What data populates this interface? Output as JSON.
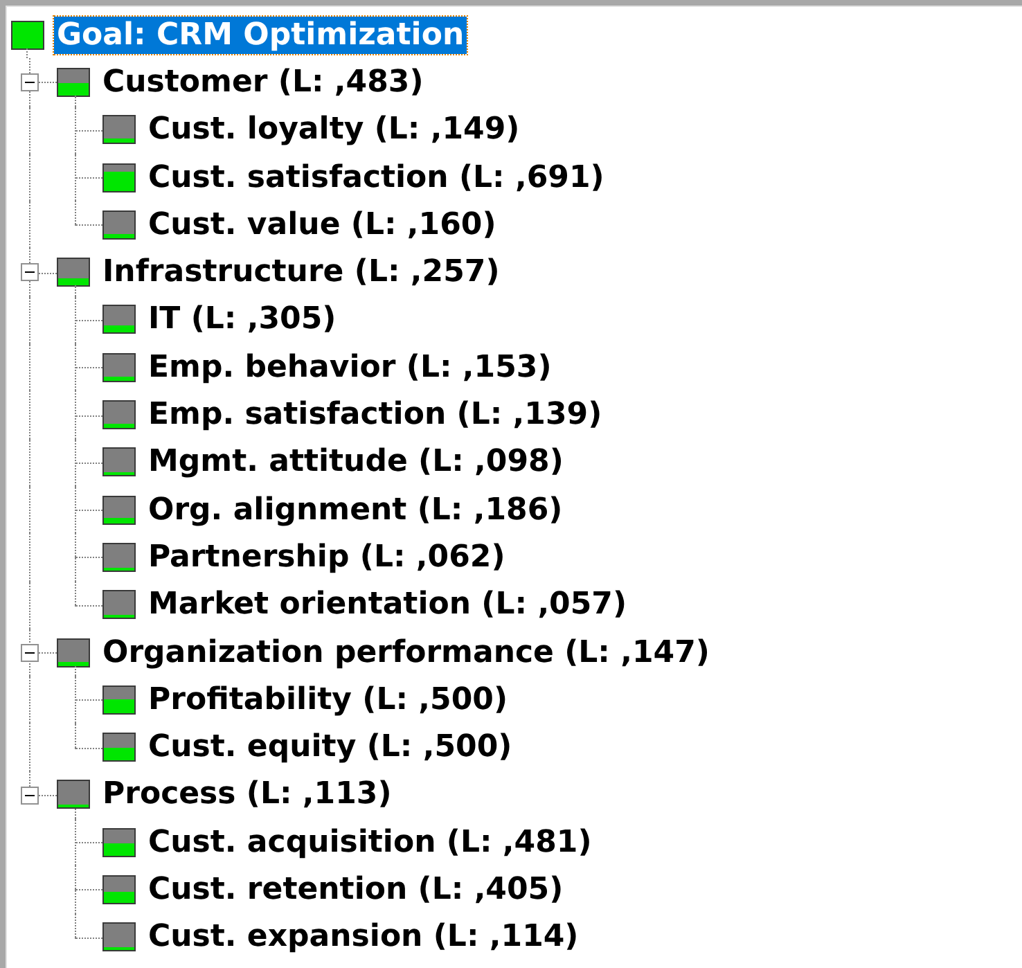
{
  "tree": [
    {
      "label": "Goal: CRM Optimization",
      "selected": true,
      "expanded": true,
      "children": [
        {
          "label": "Customer (L: ,483)",
          "selected": false,
          "expanded": true,
          "children": [
            {
              "label": "Cust. loyalty (L: ,149)",
              "selected": false
            },
            {
              "label": "Cust. satisfaction (L: ,691)",
              "selected": false
            },
            {
              "label": "Cust. value (L: ,160)",
              "selected": false
            }
          ]
        },
        {
          "label": "Infrastructure (L: ,257)",
          "selected": false,
          "expanded": true,
          "children": [
            {
              "label": "IT (L: ,305)",
              "selected": false
            },
            {
              "label": "Emp. behavior (L: ,153)",
              "selected": false
            },
            {
              "label": "Emp. satisfaction (L: ,139)",
              "selected": false
            },
            {
              "label": "Mgmt. attitude (L: ,098)",
              "selected": false
            },
            {
              "label": "Org. alignment (L: ,186)",
              "selected": false
            },
            {
              "label": "Partnership (L: ,062)",
              "selected": false
            },
            {
              "label": "Market orientation (L: ,057)",
              "selected": false
            }
          ]
        },
        {
          "label": "Organization performance (L: ,147)",
          "selected": false,
          "expanded": true,
          "children": [
            {
              "label": "Profitability (L: ,500)",
              "selected": false
            },
            {
              "label": "Cust. equity (L: ,500)",
              "selected": false
            }
          ]
        },
        {
          "label": "Process (L: ,113)",
          "selected": false,
          "expanded": true,
          "children": [
            {
              "label": "Cust. acquisition (L: ,481)",
              "selected": false
            },
            {
              "label": "Cust. retention (L: ,405)",
              "selected": false
            },
            {
              "label": "Cust. expansion (L: ,114)",
              "selected": false
            }
          ]
        }
      ]
    }
  ]
}
